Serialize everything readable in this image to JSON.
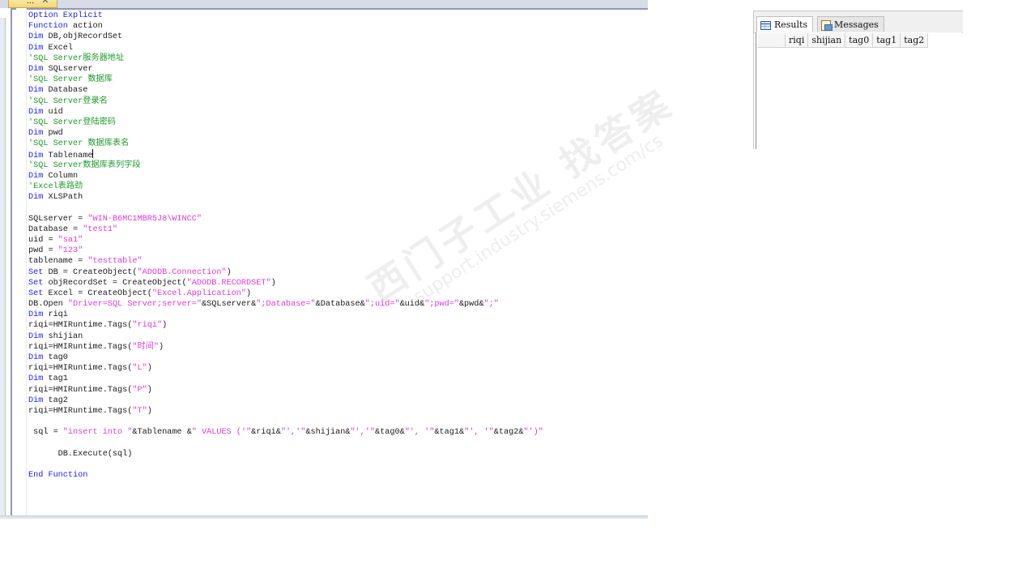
{
  "editor": {
    "tab_title": "...",
    "lines": [
      [
        {
          "t": "Option Explicit",
          "c": "kw"
        }
      ],
      [
        {
          "t": "Function",
          "c": "kw"
        },
        {
          "t": " action",
          "c": ""
        }
      ],
      [
        {
          "t": "Dim",
          "c": "kw"
        },
        {
          "t": " DB,objRecordSet",
          "c": ""
        }
      ],
      [
        {
          "t": "Dim",
          "c": "kw"
        },
        {
          "t": " Excel",
          "c": ""
        }
      ],
      [
        {
          "t": "'SQL Server服务器地址",
          "c": "cm"
        }
      ],
      [
        {
          "t": "Dim",
          "c": "kw"
        },
        {
          "t": " SQLserver",
          "c": ""
        }
      ],
      [
        {
          "t": "'SQL Server 数据库",
          "c": "cm"
        }
      ],
      [
        {
          "t": "Dim",
          "c": "kw"
        },
        {
          "t": " Database",
          "c": ""
        }
      ],
      [
        {
          "t": "'SQL Server登录名",
          "c": "cm"
        }
      ],
      [
        {
          "t": "Dim",
          "c": "kw"
        },
        {
          "t": " uid",
          "c": ""
        }
      ],
      [
        {
          "t": "'SQL Server登陆密码",
          "c": "cm"
        }
      ],
      [
        {
          "t": "Dim",
          "c": "kw"
        },
        {
          "t": " pwd",
          "c": ""
        }
      ],
      [
        {
          "t": "'SQL Server 数据库表名",
          "c": "cm"
        }
      ],
      [
        {
          "t": "Dim",
          "c": "kw"
        },
        {
          "t": " Tablename",
          "c": ""
        },
        {
          "t": "",
          "c": "caret"
        }
      ],
      [
        {
          "t": "'SQL Server数据库表列字段",
          "c": "cm"
        }
      ],
      [
        {
          "t": "Dim",
          "c": "kw"
        },
        {
          "t": " Column",
          "c": ""
        }
      ],
      [
        {
          "t": "'Excel表路劲",
          "c": "cm"
        }
      ],
      [
        {
          "t": "Dim",
          "c": "kw"
        },
        {
          "t": " XLSPath",
          "c": ""
        }
      ],
      [
        {
          "t": "",
          "c": ""
        }
      ],
      [
        {
          "t": "SQLserver = ",
          "c": ""
        },
        {
          "t": "\"WIN-B6MC1MBR5J8\\WINCC\"",
          "c": "st"
        }
      ],
      [
        {
          "t": "Database = ",
          "c": ""
        },
        {
          "t": "\"test1\"",
          "c": "st"
        }
      ],
      [
        {
          "t": "uid = ",
          "c": ""
        },
        {
          "t": "\"sa1\"",
          "c": "st"
        }
      ],
      [
        {
          "t": "pwd = ",
          "c": ""
        },
        {
          "t": "\"123\"",
          "c": "st"
        }
      ],
      [
        {
          "t": "tablename = ",
          "c": ""
        },
        {
          "t": "\"testtable\"",
          "c": "st"
        }
      ],
      [
        {
          "t": "Set",
          "c": "kw"
        },
        {
          "t": " DB = CreateObject(",
          "c": ""
        },
        {
          "t": "\"ADODB.Connection\"",
          "c": "st"
        },
        {
          "t": ")",
          "c": ""
        }
      ],
      [
        {
          "t": "Set",
          "c": "kw"
        },
        {
          "t": " objRecordSet = CreateObject(",
          "c": ""
        },
        {
          "t": "\"ADODB.RECORDSET\"",
          "c": "st"
        },
        {
          "t": ")",
          "c": ""
        }
      ],
      [
        {
          "t": "Set",
          "c": "kw"
        },
        {
          "t": " Excel = CreateObject(",
          "c": ""
        },
        {
          "t": "\"Excel.Application\"",
          "c": "st"
        },
        {
          "t": ")",
          "c": ""
        }
      ],
      [
        {
          "t": "DB.Open ",
          "c": ""
        },
        {
          "t": "\"Driver=SQL Server;server=\"",
          "c": "st"
        },
        {
          "t": "&SQLserver&",
          "c": ""
        },
        {
          "t": "\";Database=\"",
          "c": "st"
        },
        {
          "t": "&Database&",
          "c": ""
        },
        {
          "t": "\";uid=\"",
          "c": "st"
        },
        {
          "t": "&uid&",
          "c": ""
        },
        {
          "t": "\";pwd=\"",
          "c": "st"
        },
        {
          "t": "&pwd&",
          "c": ""
        },
        {
          "t": "\";\"",
          "c": "st"
        }
      ],
      [
        {
          "t": "Dim",
          "c": "kw"
        },
        {
          "t": " riqi",
          "c": ""
        }
      ],
      [
        {
          "t": "riqi=HMIRuntime.Tags(",
          "c": ""
        },
        {
          "t": "\"riqi\"",
          "c": "st"
        },
        {
          "t": ")",
          "c": ""
        }
      ],
      [
        {
          "t": "Dim",
          "c": "kw"
        },
        {
          "t": " shijian",
          "c": ""
        }
      ],
      [
        {
          "t": "riqi=HMIRuntime.Tags(",
          "c": ""
        },
        {
          "t": "\"时间\"",
          "c": "st"
        },
        {
          "t": ")",
          "c": ""
        }
      ],
      [
        {
          "t": "Dim",
          "c": "kw"
        },
        {
          "t": " tag0",
          "c": ""
        }
      ],
      [
        {
          "t": "riqi=HMIRuntime.Tags(",
          "c": ""
        },
        {
          "t": "\"L\"",
          "c": "st"
        },
        {
          "t": ")",
          "c": ""
        }
      ],
      [
        {
          "t": "Dim",
          "c": "kw"
        },
        {
          "t": " tag1",
          "c": ""
        }
      ],
      [
        {
          "t": "riqi=HMIRuntime.Tags(",
          "c": ""
        },
        {
          "t": "\"P\"",
          "c": "st"
        },
        {
          "t": ")",
          "c": ""
        }
      ],
      [
        {
          "t": "Dim",
          "c": "kw"
        },
        {
          "t": " tag2",
          "c": ""
        }
      ],
      [
        {
          "t": "riqi=HMIRuntime.Tags(",
          "c": ""
        },
        {
          "t": "\"T\"",
          "c": "st"
        },
        {
          "t": ")",
          "c": ""
        }
      ],
      [
        {
          "t": "",
          "c": ""
        }
      ],
      [
        {
          "t": " sql = ",
          "c": ""
        },
        {
          "t": "\"insert into \"",
          "c": "st"
        },
        {
          "t": "&Tablename &",
          "c": ""
        },
        {
          "t": "\" VALUES ('\"",
          "c": "st"
        },
        {
          "t": "&riqi&",
          "c": ""
        },
        {
          "t": "\"','\"",
          "c": "st"
        },
        {
          "t": "&shijian&",
          "c": ""
        },
        {
          "t": "\"','\"",
          "c": "st"
        },
        {
          "t": "&tag0&",
          "c": ""
        },
        {
          "t": "\"', '\"",
          "c": "st"
        },
        {
          "t": "&tag1&",
          "c": ""
        },
        {
          "t": "\"', '\"",
          "c": "st"
        },
        {
          "t": "&tag2&",
          "c": ""
        },
        {
          "t": "\"')\"",
          "c": "st"
        }
      ],
      [
        {
          "t": "",
          "c": ""
        }
      ],
      [
        {
          "t": "      DB.Execute(sql)",
          "c": ""
        }
      ],
      [
        {
          "t": "",
          "c": ""
        }
      ],
      [
        {
          "t": "End Function",
          "c": "kw"
        }
      ]
    ]
  },
  "watermark": {
    "main": "西门子工业 找答案",
    "url": "support.industry.siemens.com/cs"
  },
  "results": {
    "tabs": [
      {
        "label": "Results",
        "icon": "results-grid-icon",
        "active": true
      },
      {
        "label": "Messages",
        "icon": "messages-icon",
        "active": false
      }
    ],
    "columns": [
      "riqi",
      "shijian",
      "tag0",
      "tag1",
      "tag2"
    ]
  },
  "colors": {
    "keyword": "#1f22ff",
    "comment": "#1f9a2a",
    "string": "#e23ad8"
  }
}
